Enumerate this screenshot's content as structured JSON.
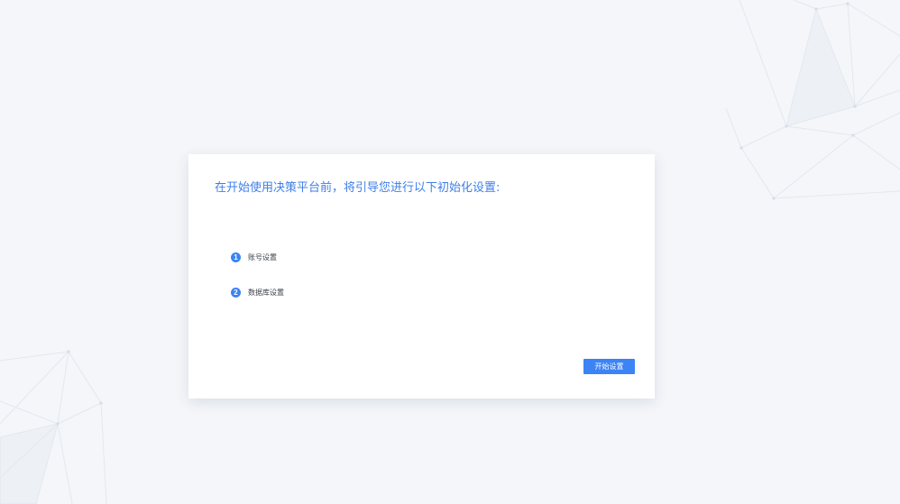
{
  "intro": {
    "title": "在开始使用决策平台前，将引导您进行以下初始化设置:"
  },
  "steps": [
    {
      "number": "1",
      "label": "账号设置"
    },
    {
      "number": "2",
      "label": "数据库设置"
    }
  ],
  "actions": {
    "start_label": "开始设置"
  },
  "colors": {
    "accent": "#3c83f5",
    "title": "#3f7fe8",
    "background": "#f4f6f9",
    "card": "#ffffff"
  }
}
